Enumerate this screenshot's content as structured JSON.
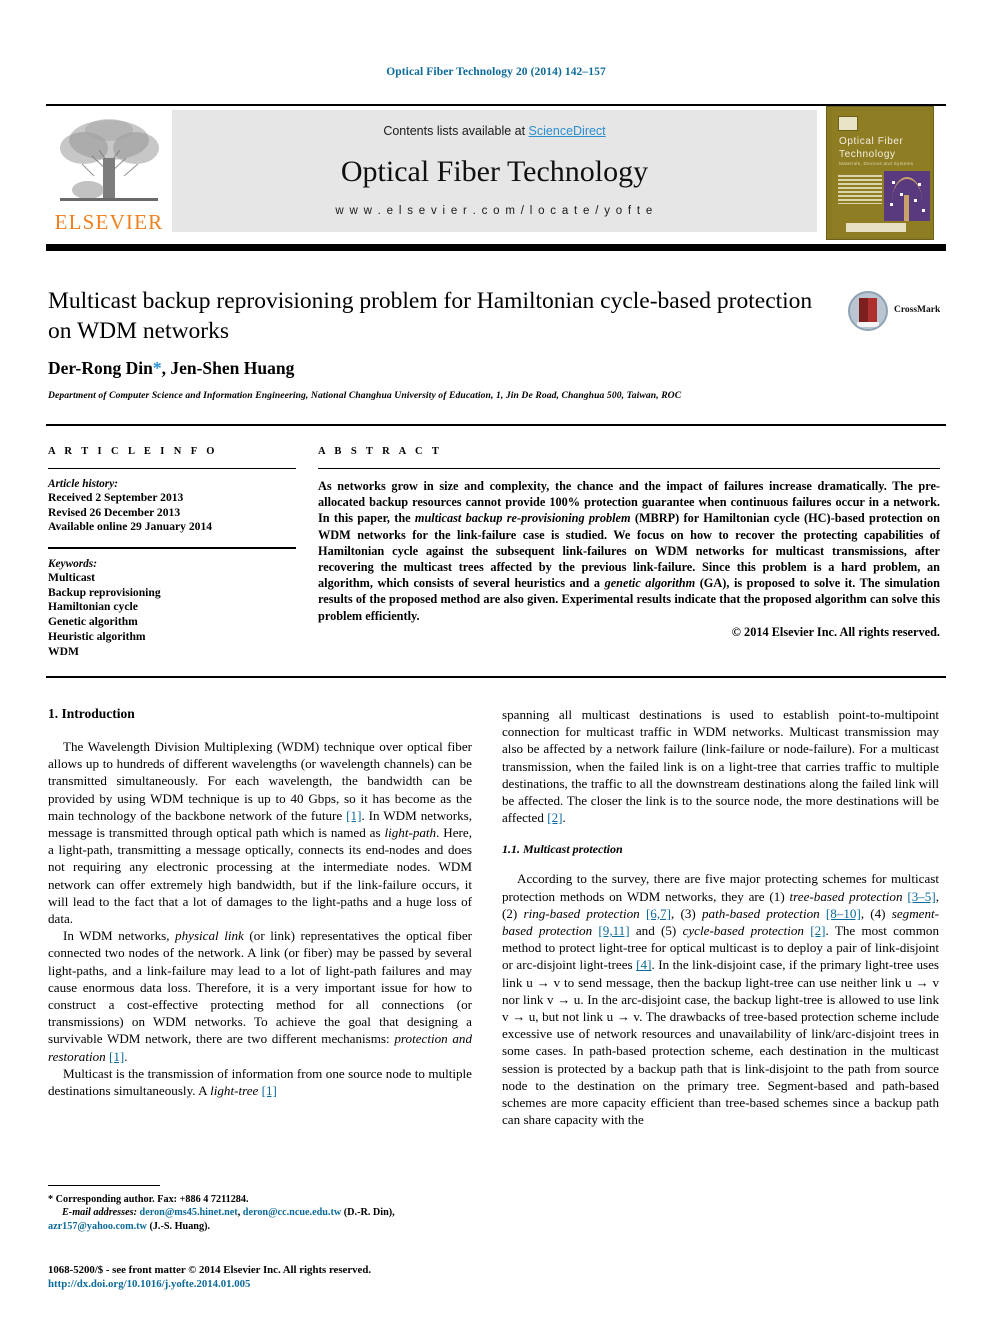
{
  "running_head": "Optical Fiber Technology 20 (2014) 142–157",
  "masthead": {
    "contents_prefix": "Contents lists available at ",
    "sciencedirect": "ScienceDirect",
    "journal_title": "Optical Fiber Technology",
    "journal_url": "w w w . e l s e v i e r . c o m / l o c a t e / y o f t e",
    "publisher_wordmark": "ELSEVIER",
    "cover": {
      "line1": "Optical Fiber",
      "line2": "Technology",
      "subtitle": "Materials, Devices and Systems"
    }
  },
  "article": {
    "title": "Multicast backup reprovisioning problem for Hamiltonian cycle-based protection on WDM networks",
    "authors": "Der-Rong Din",
    "author_star": "*",
    "authors_rest": ", Jen-Shen Huang",
    "affiliation": "Department of Computer Science and Information Engineering, National Changhua University of Education, 1, Jin De Road, Changhua 500, Taiwan, ROC",
    "crossmark_label": "CrossMark"
  },
  "article_info": {
    "heading": "A R T I C L E   I N F O",
    "history_label": "Article history:",
    "history": [
      "Received 2 September 2013",
      "Revised 26 December 2013",
      "Available online 29 January 2014"
    ],
    "keywords_label": "Keywords:",
    "keywords": [
      "Multicast",
      "Backup reprovisioning",
      "Hamiltonian cycle",
      "Genetic algorithm",
      "Heuristic algorithm",
      "WDM"
    ]
  },
  "abstract": {
    "heading": "A B S T R A C T",
    "part1": "As networks grow in size and complexity, the chance and the impact of failures increase dramatically. The pre-allocated backup resources cannot provide 100% protection guarantee when continuous failures occur in a network. In this paper, the ",
    "italic1": "multicast backup re-provisioning problem",
    "part2": " (MBRP) for Hamiltonian cycle (HC)-based protection on WDM networks for the link-failure case is studied. We focus on how to recover the protecting capabilities of Hamiltonian cycle against the subsequent link-failures on WDM networks for multicast transmissions, after recovering the multicast trees affected by the previous link-failure. Since this problem is a hard problem, an algorithm, which consists of several heuristics and a ",
    "italic2": "genetic algorithm",
    "part3": " (GA), is proposed to solve it. The simulation results of the proposed method are also given. Experimental results indicate that the proposed algorithm can solve this problem efficiently.",
    "copyright": "© 2014 Elsevier Inc. All rights reserved."
  },
  "body": {
    "section1_heading": "1. Introduction",
    "p1_a": "The Wavelength Division Multiplexing (WDM) technique over optical fiber allows up to hundreds of different wavelengths (or wavelength channels) can be transmitted simultaneously. For each wavelength, the bandwidth can be provided by using WDM technique is up to 40 Gbps, so it has become as the main technology of the backbone network of the future ",
    "p1_ref1": "[1]",
    "p1_b": ". In WDM networks, message is transmitted through optical path which is named as ",
    "p1_i1": "light-path",
    "p1_c": ". Here, a light-path, transmitting a message optically, connects its end-nodes and does not requiring any electronic processing at the intermediate nodes. WDM network can offer extremely high bandwidth, but if the link-failure occurs, it will lead to the fact that a lot of damages to the light-paths and a huge loss of data.",
    "p2_a": "In WDM networks, ",
    "p2_i1": "physical link",
    "p2_b": " (or link) representatives the optical fiber connected two nodes of the network. A link (or fiber) may be passed by several light-paths, and a link-failure may lead to a lot of light-path failures and may cause enormous data loss. Therefore, it is a very important issue for how to construct a cost-effective protecting method for all connections (or transmissions) on WDM networks. To achieve the goal that designing a survivable WDM network, there are two different mechanisms: ",
    "p2_i2": "protection and restoration",
    "p2_c": " ",
    "p2_ref1": "[1]",
    "p2_d": ".",
    "p3_a": "Multicast is the transmission of information from one source node to multiple destinations simultaneously. A ",
    "p3_i1": "light-tree",
    "p3_b": " ",
    "p3_ref1": "[1]",
    "r_p1_a": "spanning all multicast destinations is used to establish point-to-multipoint connection for multicast traffic in WDM networks. Multicast transmission may also be affected by a network failure (link-failure or node-failure). For a multicast transmission, when the failed link is on a light-tree that carries traffic to multiple destinations, the traffic to all the downstream destinations along the failed link will be affected. The closer the link is to the source node, the more destinations will be affected ",
    "r_p1_ref": "[2]",
    "r_p1_b": ".",
    "subsection_heading": "1.1. Multicast protection",
    "r_p2_a": "According to the survey, there are five major protecting schemes for multicast protection methods on WDM networks, they are (1) ",
    "r_p2_i1": "tree-based protection",
    "r_p2_ref1": "[3–5]",
    "r_p2_b": ", (2) ",
    "r_p2_i2": "ring-based protection",
    "r_p2_ref2": "[6,7]",
    "r_p2_c": ", (3) ",
    "r_p2_i3": "path-based protection",
    "r_p2_ref3": "[8–10]",
    "r_p2_d": ", (4) ",
    "r_p2_i4": "segment-based protection",
    "r_p2_ref4": "[9,11]",
    "r_p2_e": " and (5) ",
    "r_p2_i5": "cycle-based protection",
    "r_p2_ref5": "[2]",
    "r_p2_f": ". The most common method to protect light-tree for optical multicast is to deploy a pair of link-disjoint or arc-disjoint light-trees ",
    "r_p2_ref6": "[4]",
    "r_p2_g": ". In the link-disjoint case, if the primary light-tree uses link u → v to send message, then the backup light-tree can use neither link u → v nor link v → u. In the arc-disjoint case, the backup light-tree is allowed to use link v → u, but not link u → v. The drawbacks of tree-based protection scheme include excessive use of network resources and unavailability of link/arc-disjoint trees in some cases. In path-based protection scheme, each destination in the multicast session is protected by a backup path that is link-disjoint to the path from source node to the destination on the primary tree. Segment-based and path-based schemes are more capacity efficient than tree-based schemes since a backup path can share capacity with the"
  },
  "footnotes": {
    "corresponding": "* Corresponding author. Fax: +886 4 7211284.",
    "email_label": "E-mail addresses:",
    "email1": "deron@ms45.hinet.net",
    "email2": "deron@cc.ncue.edu.tw",
    "author1": "(D.-R. Din)",
    "email3": "azr157@yahoo.com.tw",
    "author2": "(J.-S. Huang)"
  },
  "imprint": {
    "line1": "1068-5200/$ - see front matter © 2014 Elsevier Inc. All rights reserved.",
    "doi": "http://dx.doi.org/10.1016/j.yofte.2014.01.005"
  },
  "colors": {
    "link": "#0b6a9a",
    "sciencedirect": "#2a8fd0",
    "elsevier_orange": "#f08020",
    "band_gray": "#e6e6e6"
  }
}
